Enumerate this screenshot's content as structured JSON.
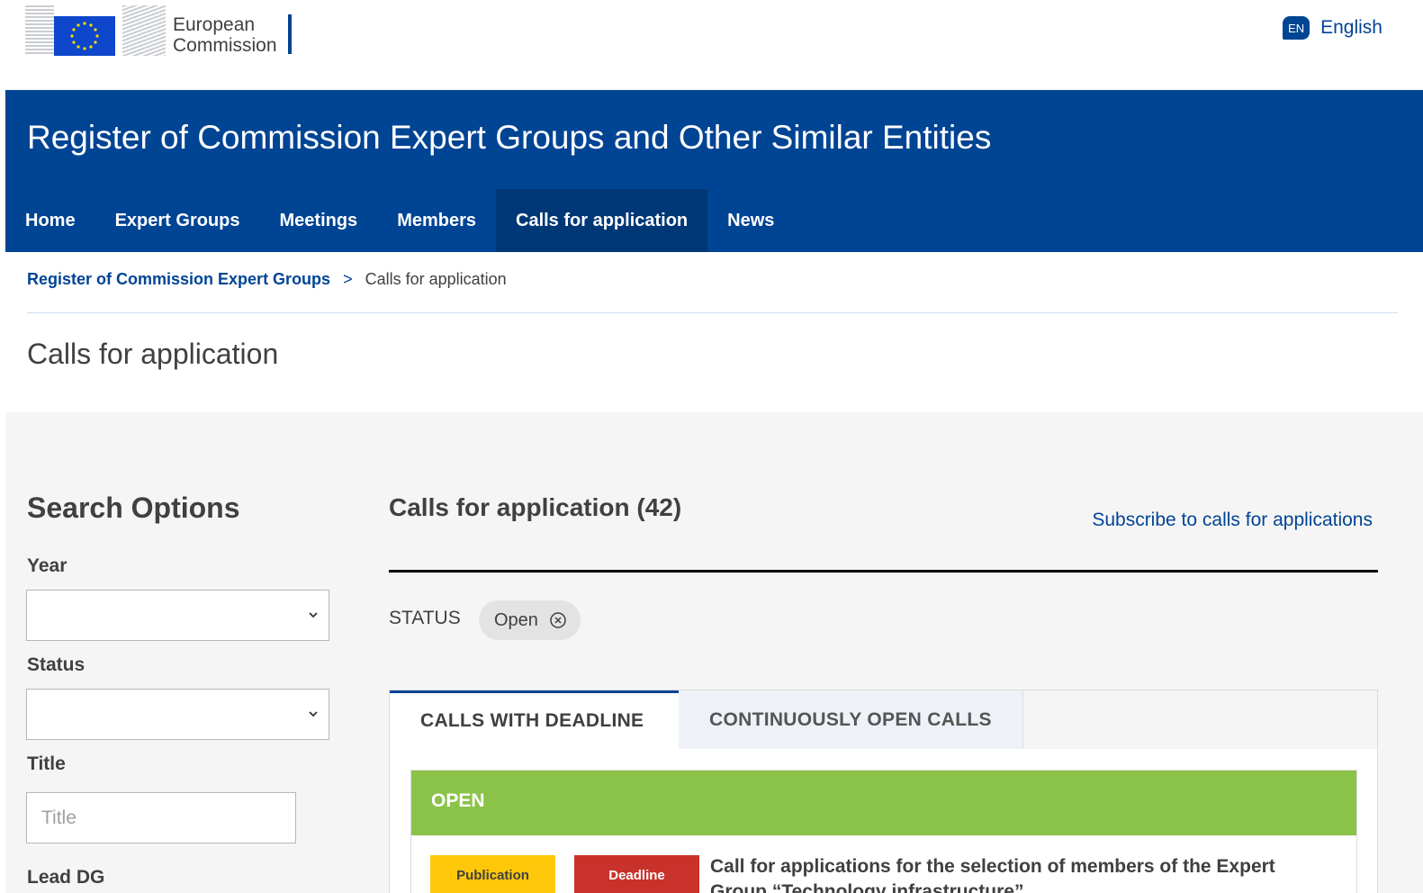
{
  "header": {
    "logo_line1": "European",
    "logo_line2": "Commission",
    "language_code": "EN",
    "language_label": "English"
  },
  "banner": {
    "site_title": "Register of Commission Expert Groups and Other Similar Entities"
  },
  "nav": {
    "items": [
      {
        "label": "Home",
        "active": false
      },
      {
        "label": "Expert Groups",
        "active": false
      },
      {
        "label": "Meetings",
        "active": false
      },
      {
        "label": "Members",
        "active": false
      },
      {
        "label": "Calls for application",
        "active": true
      },
      {
        "label": "News",
        "active": false
      }
    ]
  },
  "breadcrumb": {
    "parent": "Register of Commission Expert Groups",
    "separator": ">",
    "current": "Calls for application"
  },
  "page_title": "Calls for application",
  "search": {
    "title": "Search Options",
    "year_label": "Year",
    "year_value": "",
    "status_label": "Status",
    "status_value": "",
    "title_label": "Title",
    "title_placeholder": "Title",
    "lead_dg_label": "Lead DG"
  },
  "results": {
    "title": "Calls for application (42)",
    "subscribe_link": "Subscribe to calls for applications",
    "filter_label": "STATUS",
    "filter_chip": "Open"
  },
  "tabs": [
    {
      "label": "CALLS WITH DEADLINE",
      "active": true
    },
    {
      "label": "CONTINUOUSLY OPEN CALLS",
      "active": false
    }
  ],
  "open_section": {
    "heading": "OPEN",
    "publication_badge": "Publication",
    "deadline_badge": "Deadline",
    "call_title": "Call for applications for the selection of members of the Expert Group “Technology infrastructure”"
  },
  "colors": {
    "brand_blue": "#004494",
    "nav_active": "#003776",
    "open_green": "#8bc34a",
    "publication_yellow": "#ffc70a",
    "deadline_red": "#c9322a"
  }
}
